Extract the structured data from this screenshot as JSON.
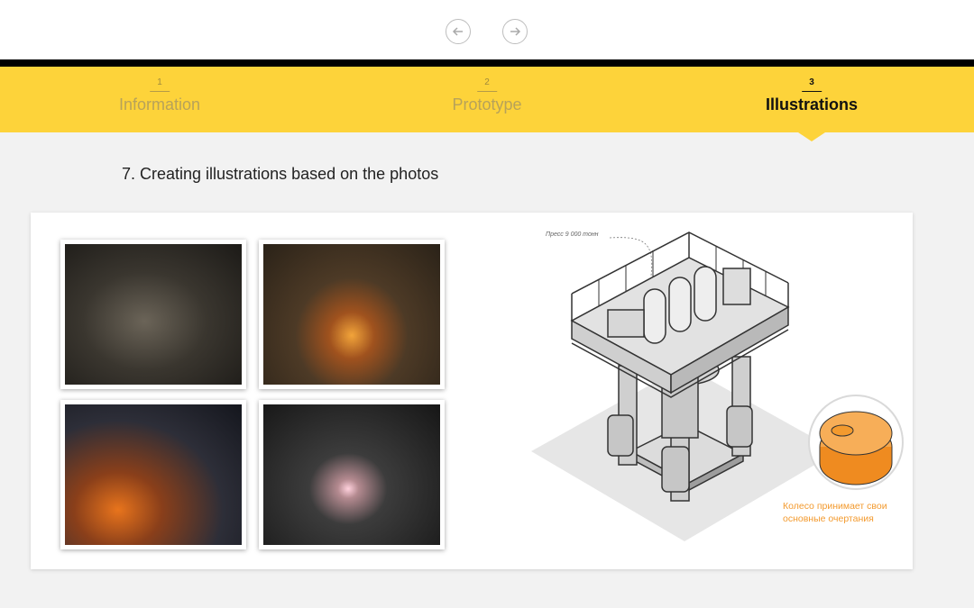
{
  "nav": {
    "prev_icon": "arrow-left-icon",
    "next_icon": "arrow-right-icon"
  },
  "tabs": [
    {
      "num": "1",
      "label": "Information",
      "active": false
    },
    {
      "num": "2",
      "label": "Prototype",
      "active": false
    },
    {
      "num": "3",
      "label": "Illustrations",
      "active": true
    }
  ],
  "section": {
    "title": "7. Creating illustrations based on the photos"
  },
  "illustration": {
    "label": "Пресс 9 000 тонн",
    "caption": "Колесо принимает свои основные очертания"
  },
  "colors": {
    "accent": "#fdd33a",
    "caption": "#f39a2e"
  }
}
